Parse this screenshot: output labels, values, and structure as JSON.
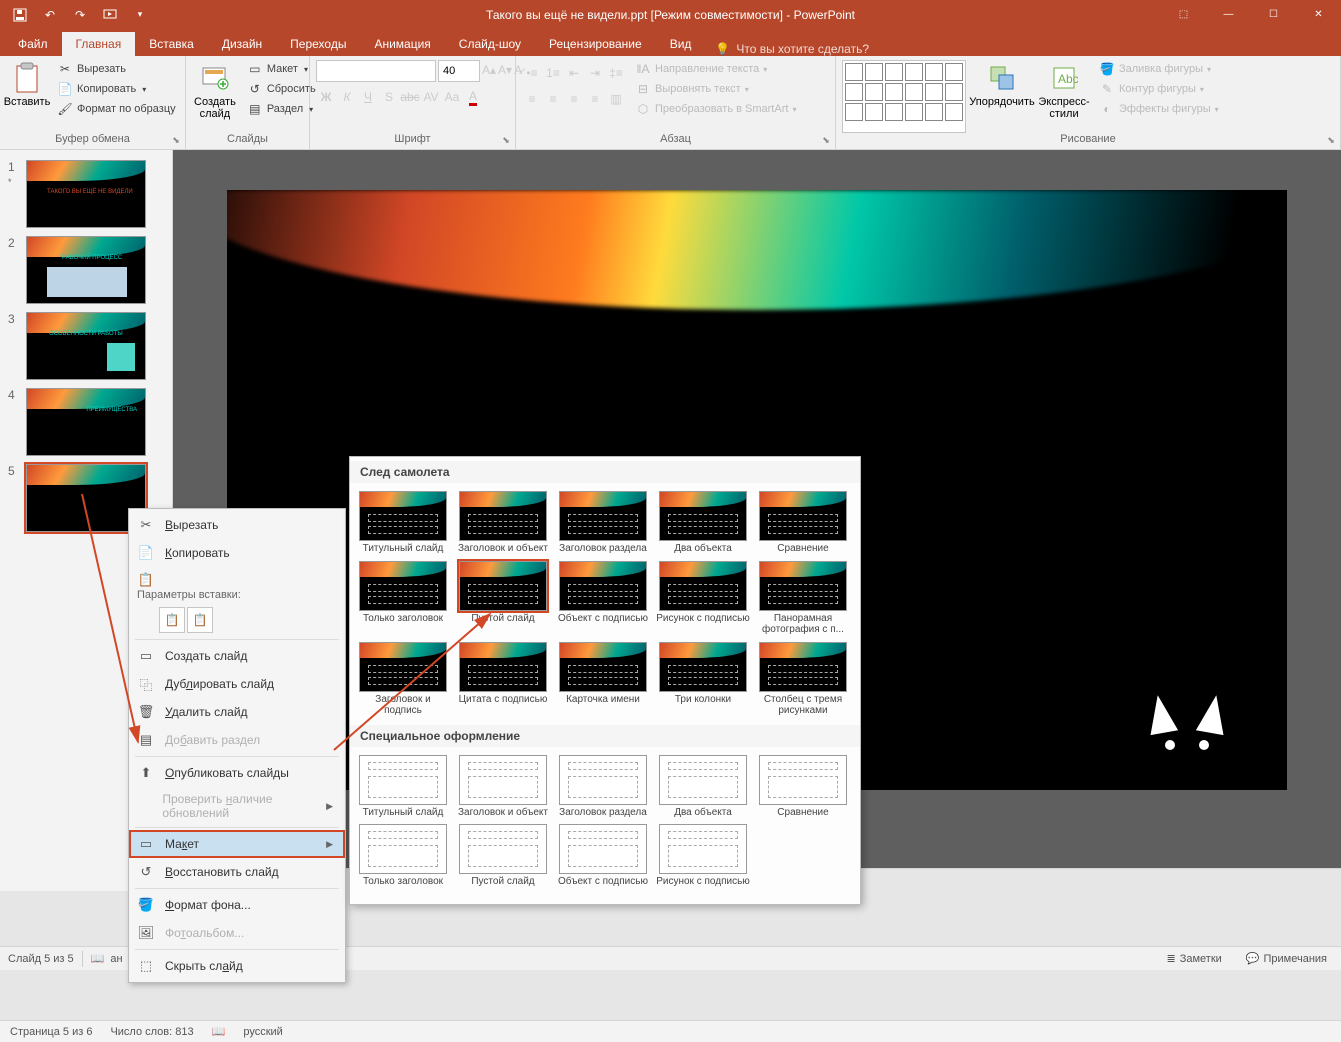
{
  "title": "Такого вы ещё не видели.ppt [Режим совместимости] - PowerPoint",
  "tabs": {
    "file": "Файл",
    "home": "Главная",
    "insert": "Вставка",
    "design": "Дизайн",
    "transitions": "Переходы",
    "animations": "Анимация",
    "slideshow": "Слайд-шоу",
    "review": "Рецензирование",
    "view": "Вид"
  },
  "tellme": "Что вы хотите сделать?",
  "ribbon": {
    "clipboard": {
      "paste": "Вставить",
      "cut": "Вырезать",
      "copy": "Копировать",
      "format_painter": "Формат по образцу",
      "label": "Буфер обмена"
    },
    "slides": {
      "new_slide": "Создать слайд",
      "layout": "Макет",
      "reset": "Сбросить",
      "section": "Раздел",
      "label": "Слайды"
    },
    "font": {
      "size": "40",
      "label": "Шрифт"
    },
    "paragraph": {
      "text_direction": "Направление текста",
      "align_text": "Выровнять текст",
      "smartart": "Преобразовать в SmartArt",
      "label": "Абзац"
    },
    "drawing": {
      "arrange": "Упорядочить",
      "quick_styles": "Экспресс-стили",
      "shape_fill": "Заливка фигуры",
      "shape_outline": "Контур фигуры",
      "shape_effects": "Эффекты фигуры",
      "label": "Рисование"
    }
  },
  "context_menu": {
    "cut": "Вырезать",
    "copy": "Копировать",
    "paste_options": "Параметры вставки:",
    "new_slide": "Создать слайд",
    "duplicate": "Дублировать слайд",
    "delete": "Удалить слайд",
    "add_section": "Добавить раздел",
    "publish": "Опубликовать слайды",
    "check_updates": "Проверить наличие обновлений",
    "layout": "Макет",
    "reset": "Восстановить слайд",
    "format_bg": "Формат фона...",
    "photoalbum": "Фотоальбом...",
    "hide": "Скрыть слайд"
  },
  "layout_gallery": {
    "theme_header": "След самолета",
    "special_header": "Специальное оформление",
    "layouts_theme": [
      "Титульный слайд",
      "Заголовок и объект",
      "Заголовок раздела",
      "Два объекта",
      "Сравнение",
      "Только заголовок",
      "Пустой слайд",
      "Объект с подписью",
      "Рисунок с подписью",
      "Панорамная фотография с п...",
      "Заголовок и подпись",
      "Цитата с подписью",
      "Карточка имени",
      "Три колонки",
      "Столбец с тремя рисунками"
    ],
    "layouts_special": [
      "Титульный слайд",
      "Заголовок и объект",
      "Заголовок раздела",
      "Два объекта",
      "Сравнение",
      "Только заголовок",
      "Пустой слайд",
      "Объект с подписью",
      "Рисунок с подписью"
    ]
  },
  "statusbar": {
    "slide_pos": "Слайд 5 из 5",
    "lang_short": "ан",
    "notes": "Заметки",
    "comments": "Примечания"
  },
  "pagestatus": {
    "page": "Страница 5 из 6",
    "words": "Число слов: 813",
    "lang": "русский"
  },
  "thumbs": {
    "t1": "ТАКОГО ВЫ ЕЩЁ НЕ ВИДЕЛИ",
    "t2": "РАБОЧИЙ ПРОЦЕСС",
    "t3": "ОСОБЕННОСТИ РАБОТЫ",
    "t4": "ПРЕИМУЩЕСТВА"
  }
}
